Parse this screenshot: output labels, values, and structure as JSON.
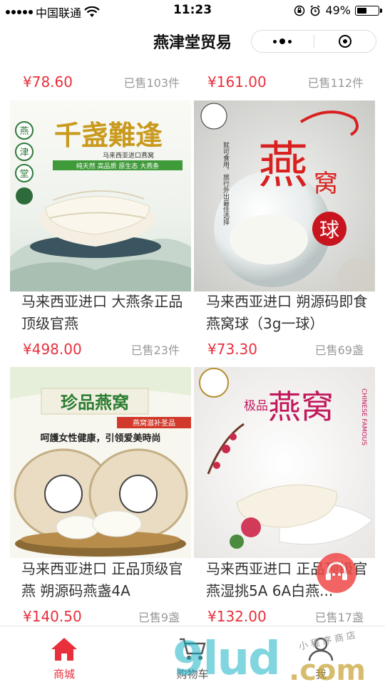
{
  "status_bar": {
    "carrier": "中国联通",
    "time": "11:23",
    "battery": "49%",
    "battery_level": 0.49
  },
  "navbar": {
    "title": "燕津堂贸易",
    "menu_icon": "more-dots-icon",
    "close_icon": "target-circle-icon"
  },
  "products": [
    {
      "name": "",
      "price": "¥78.60",
      "sold": "已售103件"
    },
    {
      "name": "",
      "price": "¥161.00",
      "sold": "已售112件"
    },
    {
      "name": "马来西亚进口 大燕条正品顶级官燕",
      "price": "¥498.00",
      "sold": "已售23件",
      "image_text": {
        "headline": "千盏難逢",
        "sub": "马来西亚进口燕窝",
        "tags": "纯天然 高品质 原生态 大燕条",
        "badge": "燕津堂"
      }
    },
    {
      "name": "马来西亚进口 朔源码即食燕窝球（3g一球）",
      "price": "¥73.30",
      "sold": "已售69盏",
      "image_text": {
        "big": "燕",
        "sub": "窝",
        "badge": "球",
        "side": "就可食用，旅行外出最佳选择"
      }
    },
    {
      "name": "马来西亚进口 正品顶级官燕 朔源码燕盏4A",
      "price": "¥140.50",
      "sold": "已售9盏",
      "image_text": {
        "headline": "珍品燕窝",
        "ribbon": "燕窝滋补圣品",
        "slogan": "呵護女性健康，引领爱美時尚"
      }
    },
    {
      "name": "马来西亚进口 正品顶级官燕湿挑5A 6A白燕...",
      "price": "¥132.00",
      "sold": "已售17盏",
      "image_text": {
        "small": "极品",
        "big": "燕窝",
        "side": "CHINESE FAMOUS"
      }
    }
  ],
  "tabbar": {
    "items": [
      {
        "label": "商城",
        "icon": "home-icon",
        "active": true
      },
      {
        "label": "购物车",
        "icon": "cart-icon",
        "active": false
      },
      {
        "label": "我",
        "icon": "user-icon",
        "active": false
      }
    ],
    "active_color": "#e8303c",
    "inactive_color": "#555555"
  },
  "watermark": {
    "brand": "9lud",
    "suffix": ".com",
    "tagline": "小程序商店"
  },
  "colors": {
    "price": "#e8303c",
    "sold": "#999999",
    "accent": "#e8303c"
  }
}
